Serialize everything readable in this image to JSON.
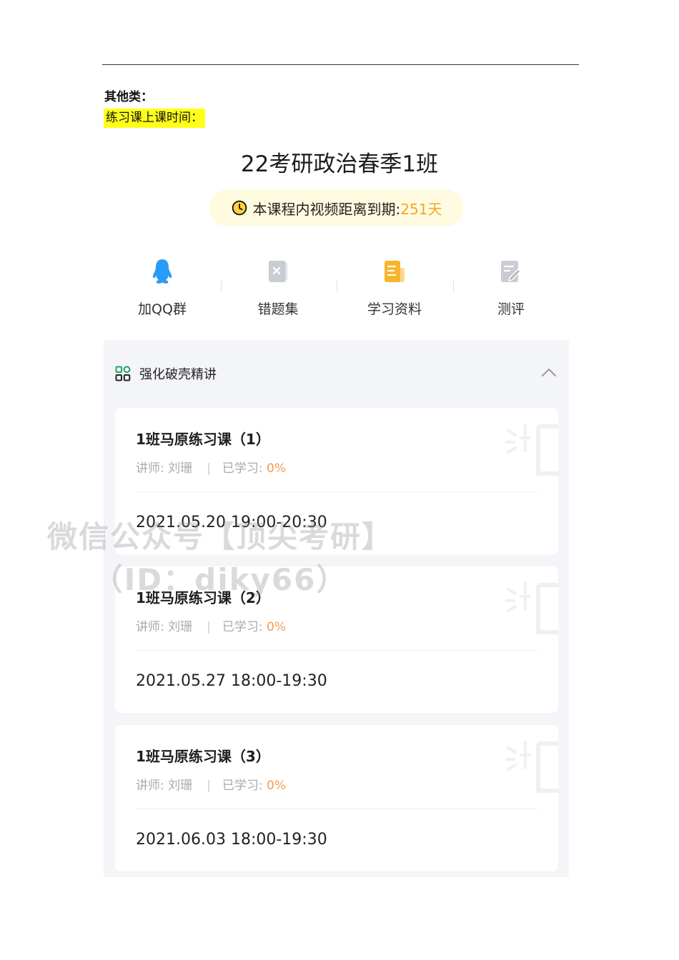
{
  "doc": {
    "category_label": "其他类：",
    "highlight_label": "练习课上课时间："
  },
  "course": {
    "title": "22考研政治春季1班",
    "expiry_label": "本课程内视频距离到期: ",
    "expiry_days": "251天"
  },
  "quick_actions": [
    {
      "label": "加QQ群",
      "icon": "qq-penguin-icon",
      "color": "#2b9cf5"
    },
    {
      "label": "错题集",
      "icon": "wrong-questions-icon",
      "color": "#c9ccd3"
    },
    {
      "label": "学习资料",
      "icon": "study-material-icon",
      "color": "#f8b42c"
    },
    {
      "label": "测评",
      "icon": "assessment-icon",
      "color": "#c9ccd3"
    }
  ],
  "section": {
    "title": "强化破壳精讲",
    "collapse_icon": "chevron-up-icon",
    "icon": "grid-apps-icon",
    "accent": "#1fa363"
  },
  "lessons": [
    {
      "title": "1班马原练习课（1）",
      "teacher": "讲师:  刘珊",
      "progress_label": "已学习: ",
      "progress": "0%",
      "time": "2021.05.20 19:00-20:30"
    },
    {
      "title": "1班马原练习课（2）",
      "teacher": "讲师:  刘珊",
      "progress_label": "已学习: ",
      "progress": "0%",
      "time": "2021.05.27 18:00-19:30"
    },
    {
      "title": "1班马原练习课（3）",
      "teacher": "讲师:  刘珊",
      "progress_label": "已学习: ",
      "progress": "0%",
      "time": "2021.06.03 18:00-19:30"
    }
  ],
  "watermark": {
    "line1": "微信公众号【顶尖考研】",
    "line2": "（ID：diky66）"
  }
}
